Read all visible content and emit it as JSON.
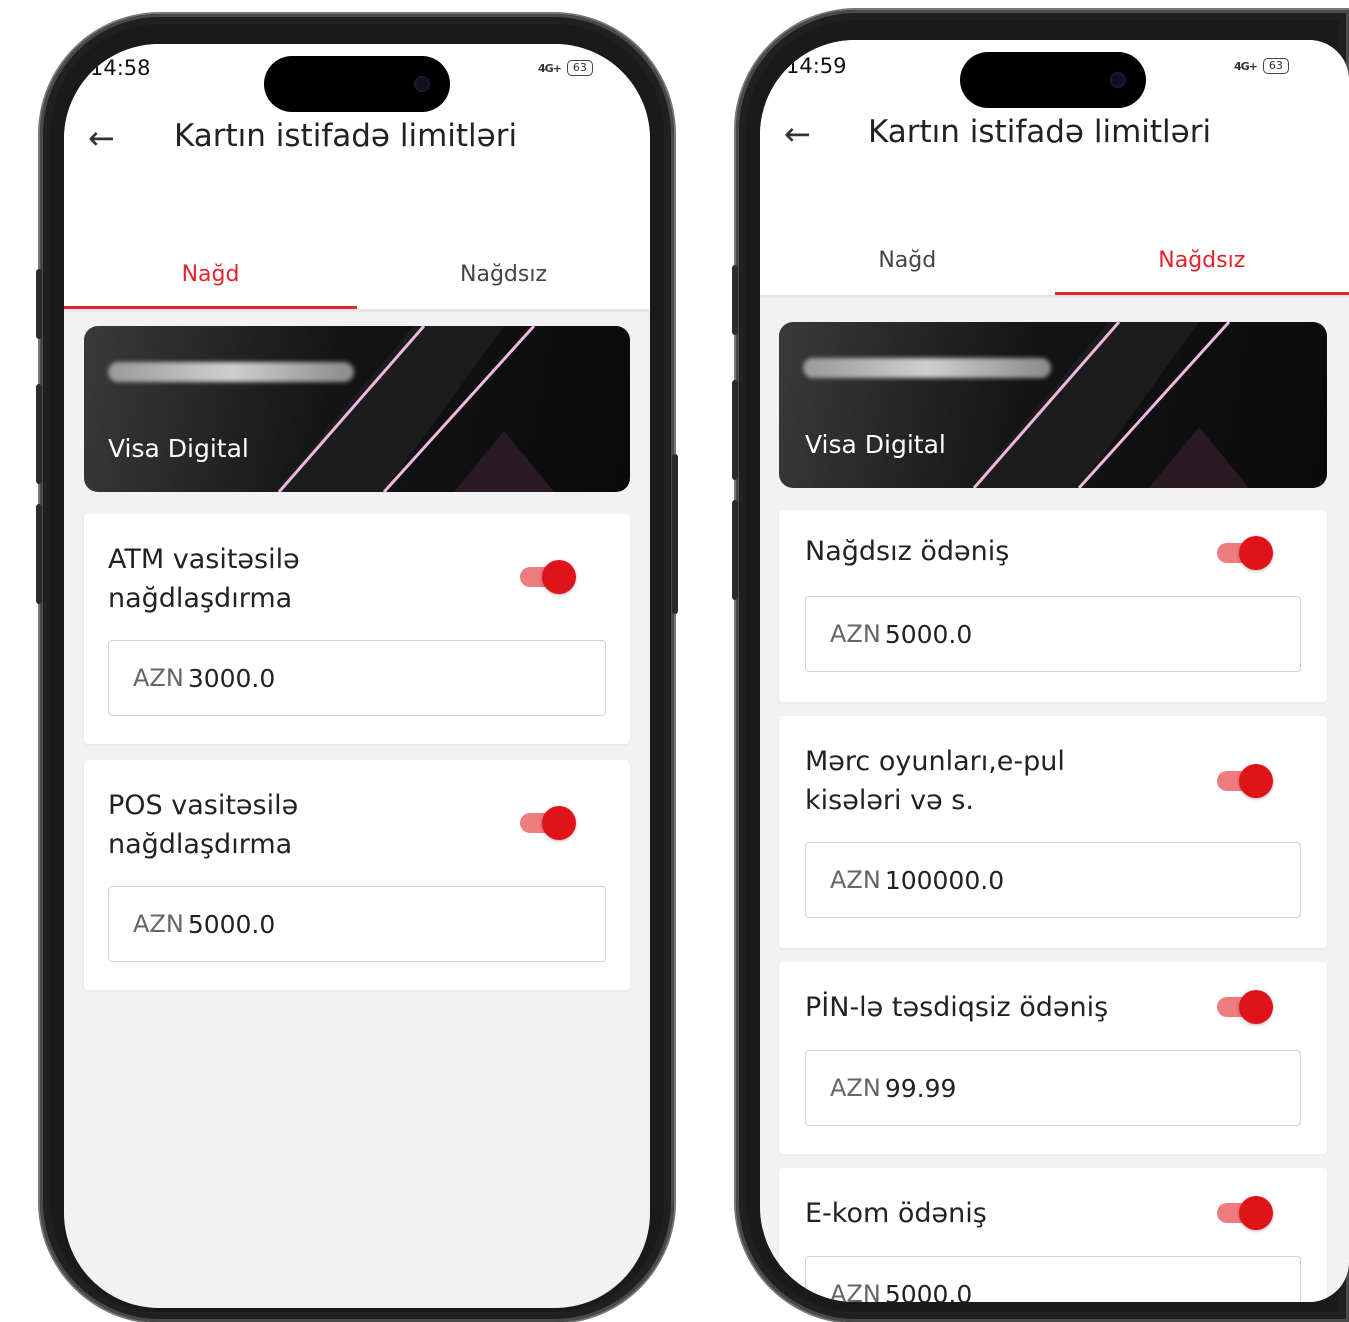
{
  "left_phone": {
    "status": {
      "time": "14:58",
      "network": "4G+",
      "battery": "63"
    },
    "header": {
      "title": "Kartın istifadə limitləri"
    },
    "tabs": [
      {
        "label": "Nağd",
        "active": true
      },
      {
        "label": "Nağdsız",
        "active": false
      }
    ],
    "card": {
      "name": "Visa Digital"
    },
    "settings": [
      {
        "label_line1": "ATM vasitəsilə",
        "label_line2": "nağdlaşdırma",
        "enabled": true,
        "currency": "AZN",
        "value": "3000.0"
      },
      {
        "label_line1": "POS vasitəsilə",
        "label_line2": "nağdlaşdırma",
        "enabled": true,
        "currency": "AZN",
        "value": "5000.0"
      }
    ]
  },
  "right_phone": {
    "status": {
      "time": "14:59",
      "network": "4G+",
      "battery": "63"
    },
    "header": {
      "title": "Kartın istifadə limitləri"
    },
    "tabs": [
      {
        "label": "Nağd",
        "active": false
      },
      {
        "label": "Nağdsız",
        "active": true
      }
    ],
    "card": {
      "name": "Visa Digital"
    },
    "settings": [
      {
        "label_line1": "Nağdsız ödəniş",
        "label_line2": "",
        "enabled": true,
        "currency": "AZN",
        "value": "5000.0"
      },
      {
        "label_line1": "Mərc oyunları,e-pul",
        "label_line2": "kisələri və s.",
        "enabled": true,
        "currency": "AZN",
        "value": "100000.0"
      },
      {
        "label_line1": "PİN-lə təsdiqsiz ödəniş",
        "label_line2": "",
        "enabled": true,
        "currency": "AZN",
        "value": "99.99"
      },
      {
        "label_line1": "E-kom ödəniş",
        "label_line2": "",
        "enabled": true,
        "currency": "AZN",
        "value": "5000.0"
      }
    ]
  },
  "colors": {
    "accent": "#e3242b",
    "toggle_knob": "#e0131b",
    "toggle_track": "#ee7b7d",
    "screen_bg": "#f2f2f2"
  },
  "icons": {
    "back": "arrow-left-icon",
    "signal": "signal-icon",
    "battery": "battery-icon"
  }
}
